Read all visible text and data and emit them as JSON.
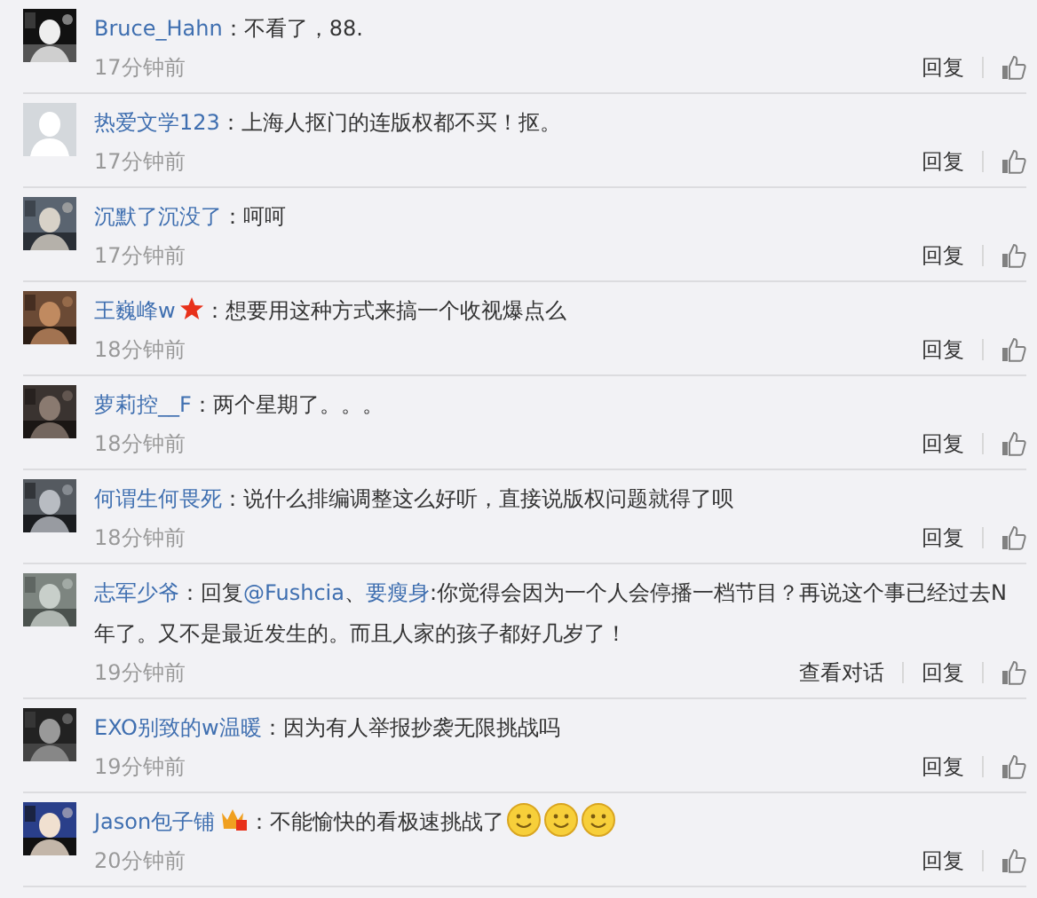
{
  "comments": [
    {
      "user": "Bruce_Hahn",
      "avatar": {
        "kind": "picture"
      },
      "content": [
        {
          "kind": "text",
          "text": "：不看了，88."
        }
      ],
      "time": "17分钟前",
      "actions": [
        "回复"
      ]
    },
    {
      "user": "热爱文学123",
      "avatar": {
        "kind": "default"
      },
      "content": [
        {
          "kind": "text",
          "text": "：上海人抠门的连版权都不买！抠。"
        }
      ],
      "time": "17分钟前",
      "actions": [
        "回复"
      ]
    },
    {
      "user": "沉默了沉没了",
      "avatar": {
        "kind": "picture"
      },
      "content": [
        {
          "kind": "text",
          "text": "：呵呵"
        }
      ],
      "time": "17分钟前",
      "actions": [
        "回复"
      ]
    },
    {
      "user": "王巍峰w",
      "badge": {
        "kind": "star"
      },
      "avatar": {
        "kind": "picture"
      },
      "content": [
        {
          "kind": "text",
          "text": "：想要用这种方式来搞一个收视爆点么"
        }
      ],
      "time": "18分钟前",
      "actions": [
        "回复"
      ]
    },
    {
      "user": "萝莉控__F",
      "avatar": {
        "kind": "picture"
      },
      "content": [
        {
          "kind": "text",
          "text": "：两个星期了。。。"
        }
      ],
      "time": "18分钟前",
      "actions": [
        "回复"
      ]
    },
    {
      "user": "何谓生何畏死",
      "avatar": {
        "kind": "picture"
      },
      "content": [
        {
          "kind": "text",
          "text": "：说什么排编调整这么好听，直接说版权问题就得了呗"
        }
      ],
      "time": "18分钟前",
      "actions": [
        "回复"
      ]
    },
    {
      "user": "志军少爷",
      "avatar": {
        "kind": "picture"
      },
      "content": [
        {
          "kind": "text",
          "text": "：回复"
        },
        {
          "kind": "link",
          "text": "@Fushcia"
        },
        {
          "kind": "text",
          "text": "、"
        },
        {
          "kind": "link",
          "text": "要瘦身"
        },
        {
          "kind": "text",
          "text": ":你觉得会因为一个人会停播一档节目？再说这个事已经过去N年了。又不是最近发生的。而且人家的孩子都好几岁了！"
        }
      ],
      "time": "19分钟前",
      "actions": [
        "查看对话",
        "回复"
      ]
    },
    {
      "user": "EXO别致的w温暖",
      "avatar": {
        "kind": "picture"
      },
      "content": [
        {
          "kind": "text",
          "text": "：因为有人举报抄袭无限挑战吗"
        }
      ],
      "time": "19分钟前",
      "actions": [
        "回复"
      ]
    },
    {
      "user": "Jason包子铺",
      "badge": {
        "kind": "crown"
      },
      "avatar": {
        "kind": "picture"
      },
      "content": [
        {
          "kind": "text",
          "text": "：不能愉快的看极速挑战了"
        },
        {
          "kind": "emoji"
        },
        {
          "kind": "emoji"
        },
        {
          "kind": "emoji"
        }
      ],
      "time": "20分钟前",
      "actions": [
        "回复"
      ]
    }
  ]
}
